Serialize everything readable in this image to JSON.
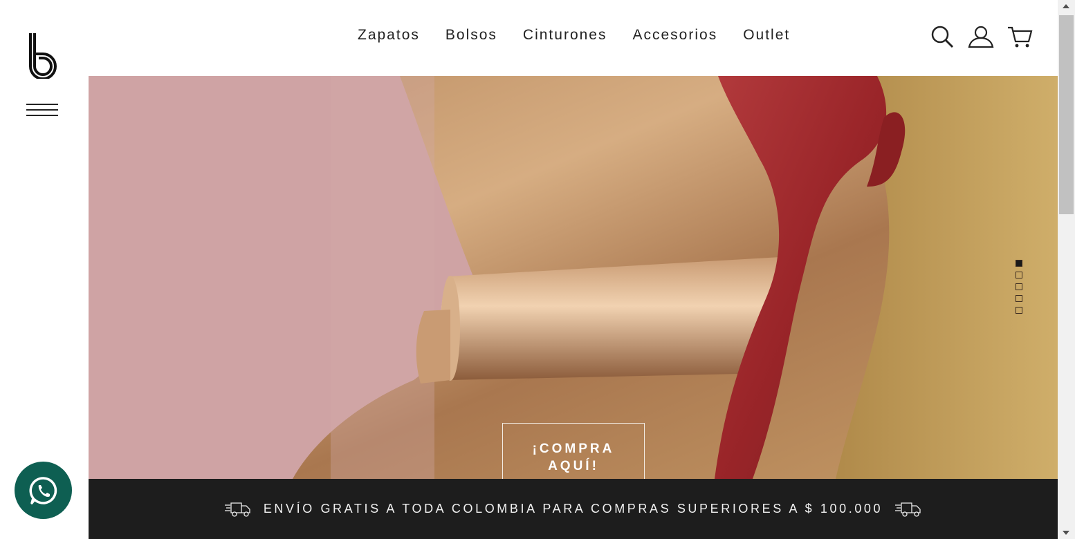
{
  "nav": {
    "items": [
      "Zapatos",
      "Bolsos",
      "Cinturones",
      "Accesorios",
      "Outlet"
    ]
  },
  "icons": {
    "logo": "b-logo",
    "menu": "hamburger-icon",
    "search": "search-icon",
    "account": "user-icon",
    "cart": "cart-icon",
    "whatsapp": "whatsapp-icon",
    "truck": "delivery-truck-icon"
  },
  "hero": {
    "cta_line1": "¡COMPRA",
    "cta_line2": "AQUÍ!",
    "slides_total": 5,
    "active_slide": 1
  },
  "banner": {
    "text": "ENVÍO GRATIS A TODA COLOMBIA PARA COMPRAS SUPERIORES A $ 100.000"
  },
  "colors": {
    "accent_dark": "#1d1d1d",
    "whatsapp_green": "#0e5f52",
    "hero_pink": "#cfa3a4",
    "hero_gold": "#c9a07a",
    "hero_red": "#9e2a2e"
  }
}
